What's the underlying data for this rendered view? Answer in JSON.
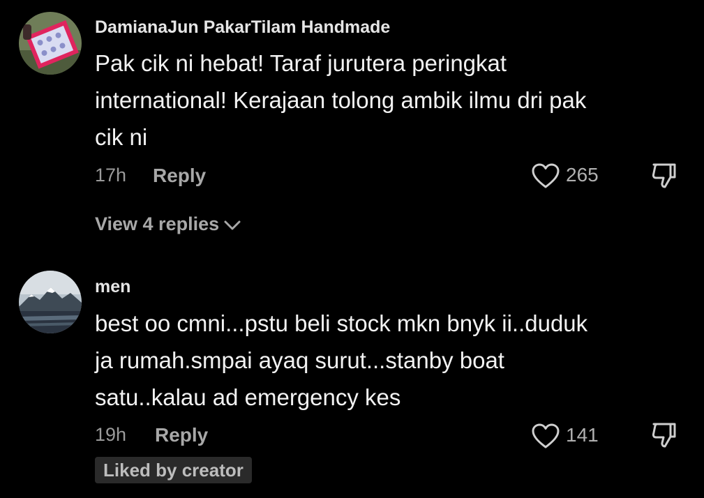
{
  "comments": [
    {
      "username": "DamianaJun PakarTilam Handmade",
      "lines": [
        "Pak cik ni hebat! Taraf jurutera peringkat",
        "international! Kerajaan tolong ambik ilmu dri pak",
        "cik ni"
      ],
      "time": "17h",
      "reply_label": "Reply",
      "likes": "265",
      "view_replies": "View 4 replies",
      "avatar_icon": "mattress-product-avatar"
    },
    {
      "username": "men",
      "lines": [
        "best oo cmni...pstu beli stock mkn bnyk ii..duduk",
        "ja rumah.smpai ayaq surut...stanby boat",
        "satu..kalau ad emergency kes"
      ],
      "time": "19h",
      "reply_label": "Reply",
      "likes": "141",
      "badge": "Liked by creator",
      "avatar_icon": "mountain-landscape-avatar"
    }
  ],
  "colors": {
    "background": "#000000",
    "text": "#f2f2f2",
    "muted": "#9a9a9a",
    "badge_bg": "#2a2a2a"
  }
}
